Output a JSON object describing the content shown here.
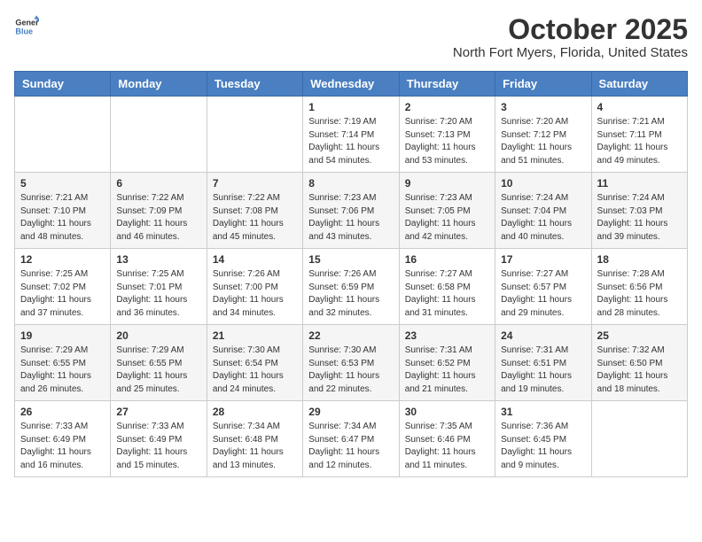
{
  "header": {
    "logo_general": "General",
    "logo_blue": "Blue",
    "month": "October 2025",
    "location": "North Fort Myers, Florida, United States"
  },
  "days_of_week": [
    "Sunday",
    "Monday",
    "Tuesday",
    "Wednesday",
    "Thursday",
    "Friday",
    "Saturday"
  ],
  "weeks": [
    [
      {
        "day": "",
        "sunrise": "",
        "sunset": "",
        "daylight": ""
      },
      {
        "day": "",
        "sunrise": "",
        "sunset": "",
        "daylight": ""
      },
      {
        "day": "",
        "sunrise": "",
        "sunset": "",
        "daylight": ""
      },
      {
        "day": "1",
        "sunrise": "Sunrise: 7:19 AM",
        "sunset": "Sunset: 7:14 PM",
        "daylight": "Daylight: 11 hours and 54 minutes."
      },
      {
        "day": "2",
        "sunrise": "Sunrise: 7:20 AM",
        "sunset": "Sunset: 7:13 PM",
        "daylight": "Daylight: 11 hours and 53 minutes."
      },
      {
        "day": "3",
        "sunrise": "Sunrise: 7:20 AM",
        "sunset": "Sunset: 7:12 PM",
        "daylight": "Daylight: 11 hours and 51 minutes."
      },
      {
        "day": "4",
        "sunrise": "Sunrise: 7:21 AM",
        "sunset": "Sunset: 7:11 PM",
        "daylight": "Daylight: 11 hours and 49 minutes."
      }
    ],
    [
      {
        "day": "5",
        "sunrise": "Sunrise: 7:21 AM",
        "sunset": "Sunset: 7:10 PM",
        "daylight": "Daylight: 11 hours and 48 minutes."
      },
      {
        "day": "6",
        "sunrise": "Sunrise: 7:22 AM",
        "sunset": "Sunset: 7:09 PM",
        "daylight": "Daylight: 11 hours and 46 minutes."
      },
      {
        "day": "7",
        "sunrise": "Sunrise: 7:22 AM",
        "sunset": "Sunset: 7:08 PM",
        "daylight": "Daylight: 11 hours and 45 minutes."
      },
      {
        "day": "8",
        "sunrise": "Sunrise: 7:23 AM",
        "sunset": "Sunset: 7:06 PM",
        "daylight": "Daylight: 11 hours and 43 minutes."
      },
      {
        "day": "9",
        "sunrise": "Sunrise: 7:23 AM",
        "sunset": "Sunset: 7:05 PM",
        "daylight": "Daylight: 11 hours and 42 minutes."
      },
      {
        "day": "10",
        "sunrise": "Sunrise: 7:24 AM",
        "sunset": "Sunset: 7:04 PM",
        "daylight": "Daylight: 11 hours and 40 minutes."
      },
      {
        "day": "11",
        "sunrise": "Sunrise: 7:24 AM",
        "sunset": "Sunset: 7:03 PM",
        "daylight": "Daylight: 11 hours and 39 minutes."
      }
    ],
    [
      {
        "day": "12",
        "sunrise": "Sunrise: 7:25 AM",
        "sunset": "Sunset: 7:02 PM",
        "daylight": "Daylight: 11 hours and 37 minutes."
      },
      {
        "day": "13",
        "sunrise": "Sunrise: 7:25 AM",
        "sunset": "Sunset: 7:01 PM",
        "daylight": "Daylight: 11 hours and 36 minutes."
      },
      {
        "day": "14",
        "sunrise": "Sunrise: 7:26 AM",
        "sunset": "Sunset: 7:00 PM",
        "daylight": "Daylight: 11 hours and 34 minutes."
      },
      {
        "day": "15",
        "sunrise": "Sunrise: 7:26 AM",
        "sunset": "Sunset: 6:59 PM",
        "daylight": "Daylight: 11 hours and 32 minutes."
      },
      {
        "day": "16",
        "sunrise": "Sunrise: 7:27 AM",
        "sunset": "Sunset: 6:58 PM",
        "daylight": "Daylight: 11 hours and 31 minutes."
      },
      {
        "day": "17",
        "sunrise": "Sunrise: 7:27 AM",
        "sunset": "Sunset: 6:57 PM",
        "daylight": "Daylight: 11 hours and 29 minutes."
      },
      {
        "day": "18",
        "sunrise": "Sunrise: 7:28 AM",
        "sunset": "Sunset: 6:56 PM",
        "daylight": "Daylight: 11 hours and 28 minutes."
      }
    ],
    [
      {
        "day": "19",
        "sunrise": "Sunrise: 7:29 AM",
        "sunset": "Sunset: 6:55 PM",
        "daylight": "Daylight: 11 hours and 26 minutes."
      },
      {
        "day": "20",
        "sunrise": "Sunrise: 7:29 AM",
        "sunset": "Sunset: 6:55 PM",
        "daylight": "Daylight: 11 hours and 25 minutes."
      },
      {
        "day": "21",
        "sunrise": "Sunrise: 7:30 AM",
        "sunset": "Sunset: 6:54 PM",
        "daylight": "Daylight: 11 hours and 24 minutes."
      },
      {
        "day": "22",
        "sunrise": "Sunrise: 7:30 AM",
        "sunset": "Sunset: 6:53 PM",
        "daylight": "Daylight: 11 hours and 22 minutes."
      },
      {
        "day": "23",
        "sunrise": "Sunrise: 7:31 AM",
        "sunset": "Sunset: 6:52 PM",
        "daylight": "Daylight: 11 hours and 21 minutes."
      },
      {
        "day": "24",
        "sunrise": "Sunrise: 7:31 AM",
        "sunset": "Sunset: 6:51 PM",
        "daylight": "Daylight: 11 hours and 19 minutes."
      },
      {
        "day": "25",
        "sunrise": "Sunrise: 7:32 AM",
        "sunset": "Sunset: 6:50 PM",
        "daylight": "Daylight: 11 hours and 18 minutes."
      }
    ],
    [
      {
        "day": "26",
        "sunrise": "Sunrise: 7:33 AM",
        "sunset": "Sunset: 6:49 PM",
        "daylight": "Daylight: 11 hours and 16 minutes."
      },
      {
        "day": "27",
        "sunrise": "Sunrise: 7:33 AM",
        "sunset": "Sunset: 6:49 PM",
        "daylight": "Daylight: 11 hours and 15 minutes."
      },
      {
        "day": "28",
        "sunrise": "Sunrise: 7:34 AM",
        "sunset": "Sunset: 6:48 PM",
        "daylight": "Daylight: 11 hours and 13 minutes."
      },
      {
        "day": "29",
        "sunrise": "Sunrise: 7:34 AM",
        "sunset": "Sunset: 6:47 PM",
        "daylight": "Daylight: 11 hours and 12 minutes."
      },
      {
        "day": "30",
        "sunrise": "Sunrise: 7:35 AM",
        "sunset": "Sunset: 6:46 PM",
        "daylight": "Daylight: 11 hours and 11 minutes."
      },
      {
        "day": "31",
        "sunrise": "Sunrise: 7:36 AM",
        "sunset": "Sunset: 6:45 PM",
        "daylight": "Daylight: 11 hours and 9 minutes."
      },
      {
        "day": "",
        "sunrise": "",
        "sunset": "",
        "daylight": ""
      }
    ]
  ]
}
